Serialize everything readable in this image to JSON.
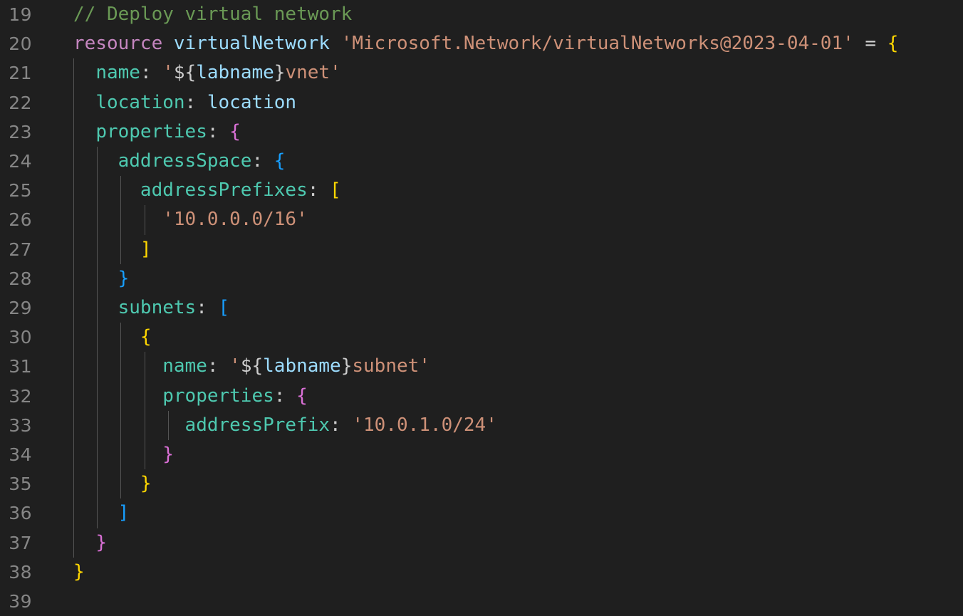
{
  "editor": {
    "language": "bicep",
    "theme": "dark-plus",
    "background": "#1f1f1f",
    "line_number_color": "#868686",
    "indent_guide_color": "#545454",
    "first_visible_line": 19,
    "last_visible_line": 39,
    "bracket_colors": [
      "#FFD700",
      "#DA70D6",
      "#179FFF"
    ],
    "token_colors": {
      "comment": "#6A9955",
      "keyword": "#C586C0",
      "identifier": "#9CDCFE",
      "string": "#CE9178",
      "property": "#4EC9B0",
      "operator": "#D4D4D4",
      "punctuation": "#CCCCCC"
    }
  },
  "lines": [
    {
      "number": "19",
      "indent_guides": 0,
      "tokens": [
        {
          "text": "// Deploy virtual network",
          "cls": "t-comment"
        }
      ]
    },
    {
      "number": "20",
      "indent_guides": 0,
      "tokens": [
        {
          "text": "resource",
          "cls": "t-keyword"
        },
        {
          "text": " ",
          "cls": "t-plain"
        },
        {
          "text": "virtualNetwork",
          "cls": "t-ident"
        },
        {
          "text": " ",
          "cls": "t-plain"
        },
        {
          "text": "'Microsoft.Network/virtualNetworks@2023-04-01'",
          "cls": "t-string"
        },
        {
          "text": " ",
          "cls": "t-plain"
        },
        {
          "text": "=",
          "cls": "t-plain"
        },
        {
          "text": " ",
          "cls": "t-plain"
        },
        {
          "text": "{",
          "cls": "t-b1"
        }
      ]
    },
    {
      "number": "21",
      "indent_guides": 1,
      "tokens": [
        {
          "text": "  ",
          "cls": "t-plain"
        },
        {
          "text": "name",
          "cls": "t-prop"
        },
        {
          "text": ":",
          "cls": "t-punct"
        },
        {
          "text": " ",
          "cls": "t-plain"
        },
        {
          "text": "'",
          "cls": "t-string"
        },
        {
          "text": "${",
          "cls": "t-punct"
        },
        {
          "text": "labname",
          "cls": "t-ident"
        },
        {
          "text": "}",
          "cls": "t-punct"
        },
        {
          "text": "vnet'",
          "cls": "t-string"
        }
      ]
    },
    {
      "number": "22",
      "indent_guides": 1,
      "tokens": [
        {
          "text": "  ",
          "cls": "t-plain"
        },
        {
          "text": "location",
          "cls": "t-prop"
        },
        {
          "text": ":",
          "cls": "t-punct"
        },
        {
          "text": " ",
          "cls": "t-plain"
        },
        {
          "text": "location",
          "cls": "t-ident"
        }
      ]
    },
    {
      "number": "23",
      "indent_guides": 1,
      "tokens": [
        {
          "text": "  ",
          "cls": "t-plain"
        },
        {
          "text": "properties",
          "cls": "t-prop"
        },
        {
          "text": ":",
          "cls": "t-punct"
        },
        {
          "text": " ",
          "cls": "t-plain"
        },
        {
          "text": "{",
          "cls": "t-b2"
        }
      ]
    },
    {
      "number": "24",
      "indent_guides": 2,
      "tokens": [
        {
          "text": "    ",
          "cls": "t-plain"
        },
        {
          "text": "addressSpace",
          "cls": "t-prop"
        },
        {
          "text": ":",
          "cls": "t-punct"
        },
        {
          "text": " ",
          "cls": "t-plain"
        },
        {
          "text": "{",
          "cls": "t-b3"
        }
      ]
    },
    {
      "number": "25",
      "indent_guides": 3,
      "tokens": [
        {
          "text": "      ",
          "cls": "t-plain"
        },
        {
          "text": "addressPrefixes",
          "cls": "t-prop"
        },
        {
          "text": ":",
          "cls": "t-punct"
        },
        {
          "text": " ",
          "cls": "t-plain"
        },
        {
          "text": "[",
          "cls": "t-b1"
        }
      ]
    },
    {
      "number": "26",
      "indent_guides": 4,
      "tokens": [
        {
          "text": "        ",
          "cls": "t-plain"
        },
        {
          "text": "'10.0.0.0/16'",
          "cls": "t-string"
        }
      ]
    },
    {
      "number": "27",
      "indent_guides": 3,
      "tokens": [
        {
          "text": "      ",
          "cls": "t-plain"
        },
        {
          "text": "]",
          "cls": "t-b1"
        }
      ]
    },
    {
      "number": "28",
      "indent_guides": 2,
      "tokens": [
        {
          "text": "    ",
          "cls": "t-plain"
        },
        {
          "text": "}",
          "cls": "t-b3"
        }
      ]
    },
    {
      "number": "29",
      "indent_guides": 2,
      "tokens": [
        {
          "text": "    ",
          "cls": "t-plain"
        },
        {
          "text": "subnets",
          "cls": "t-prop"
        },
        {
          "text": ":",
          "cls": "t-punct"
        },
        {
          "text": " ",
          "cls": "t-plain"
        },
        {
          "text": "[",
          "cls": "t-b3"
        }
      ]
    },
    {
      "number": "30",
      "indent_guides": 3,
      "tokens": [
        {
          "text": "      ",
          "cls": "t-plain"
        },
        {
          "text": "{",
          "cls": "t-b1"
        }
      ]
    },
    {
      "number": "31",
      "indent_guides": 4,
      "tokens": [
        {
          "text": "        ",
          "cls": "t-plain"
        },
        {
          "text": "name",
          "cls": "t-prop"
        },
        {
          "text": ":",
          "cls": "t-punct"
        },
        {
          "text": " ",
          "cls": "t-plain"
        },
        {
          "text": "'",
          "cls": "t-string"
        },
        {
          "text": "${",
          "cls": "t-punct"
        },
        {
          "text": "labname",
          "cls": "t-ident"
        },
        {
          "text": "}",
          "cls": "t-punct"
        },
        {
          "text": "subnet'",
          "cls": "t-string"
        }
      ]
    },
    {
      "number": "32",
      "indent_guides": 4,
      "tokens": [
        {
          "text": "        ",
          "cls": "t-plain"
        },
        {
          "text": "properties",
          "cls": "t-prop"
        },
        {
          "text": ":",
          "cls": "t-punct"
        },
        {
          "text": " ",
          "cls": "t-plain"
        },
        {
          "text": "{",
          "cls": "t-b2"
        }
      ]
    },
    {
      "number": "33",
      "indent_guides": 5,
      "tokens": [
        {
          "text": "          ",
          "cls": "t-plain"
        },
        {
          "text": "addressPrefix",
          "cls": "t-prop"
        },
        {
          "text": ":",
          "cls": "t-punct"
        },
        {
          "text": " ",
          "cls": "t-plain"
        },
        {
          "text": "'10.0.1.0/24'",
          "cls": "t-string"
        }
      ]
    },
    {
      "number": "34",
      "indent_guides": 4,
      "tokens": [
        {
          "text": "        ",
          "cls": "t-plain"
        },
        {
          "text": "}",
          "cls": "t-b2"
        }
      ]
    },
    {
      "number": "35",
      "indent_guides": 3,
      "tokens": [
        {
          "text": "      ",
          "cls": "t-plain"
        },
        {
          "text": "}",
          "cls": "t-b1"
        }
      ]
    },
    {
      "number": "36",
      "indent_guides": 2,
      "tokens": [
        {
          "text": "    ",
          "cls": "t-plain"
        },
        {
          "text": "]",
          "cls": "t-b3"
        }
      ]
    },
    {
      "number": "37",
      "indent_guides": 1,
      "tokens": [
        {
          "text": "  ",
          "cls": "t-plain"
        },
        {
          "text": "}",
          "cls": "t-b2"
        }
      ]
    },
    {
      "number": "38",
      "indent_guides": 0,
      "tokens": [
        {
          "text": "}",
          "cls": "t-b1"
        }
      ]
    },
    {
      "number": "39",
      "indent_guides": 0,
      "tokens": []
    }
  ]
}
